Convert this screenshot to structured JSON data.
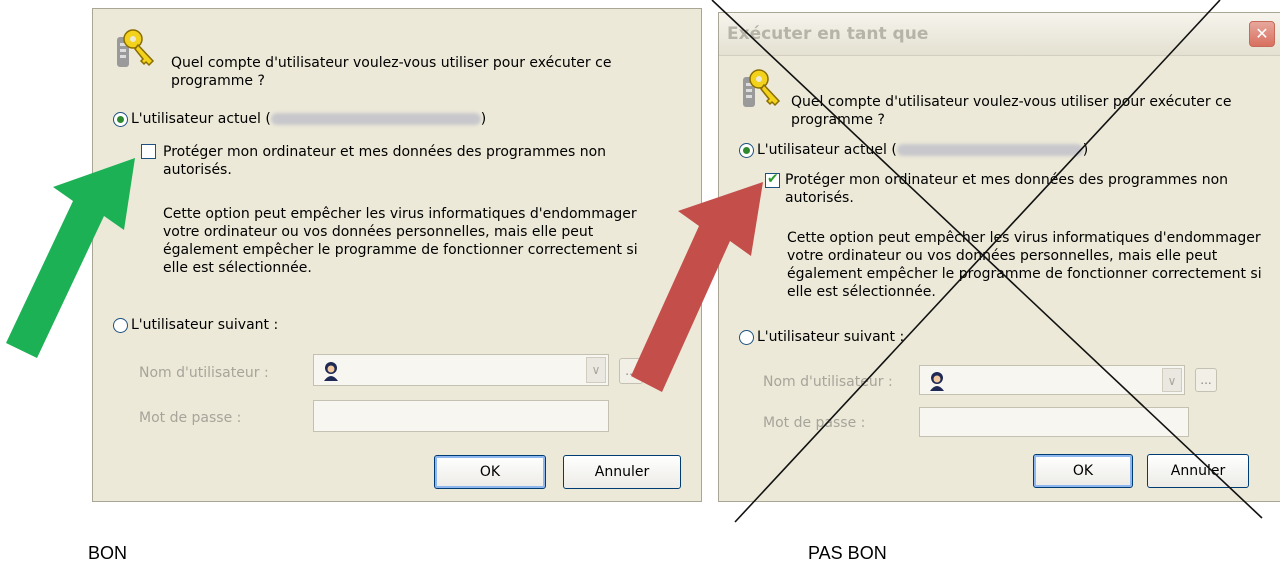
{
  "left_dialog": {
    "question_line1": "Quel compte d'utilisateur voulez-vous utiliser pour exécuter ce",
    "question_line2": "programme ?",
    "current_user_prefix": "L'utilisateur actuel (",
    "current_user_suffix": ")",
    "current_user_selected": true,
    "protect_checked": false,
    "protect_line1": "Protéger mon ordinateur et mes données des programmes non",
    "protect_line2": "autorisés.",
    "desc_line1": "Cette option peut empêcher les virus informatiques d'endommager",
    "desc_line2": "votre ordinateur ou vos données personnelles, mais elle peut",
    "desc_line3": "également empêcher le programme de fonctionner correctement si",
    "desc_line4": "elle est sélectionnée.",
    "following_user_label": "L'utilisateur suivant :",
    "username_label": "Nom d'utilisateur :",
    "password_label": "Mot de passe :",
    "browse_label": "...",
    "ok_label": "OK",
    "cancel_label": "Annuler"
  },
  "right_dialog": {
    "title": "Exécuter en tant que",
    "close_glyph": "✕",
    "question_line1": "Quel compte d'utilisateur voulez-vous utiliser pour exécuter ce",
    "question_line2": "programme ?",
    "current_user_prefix": "L'utilisateur actuel (",
    "current_user_suffix": ")",
    "current_user_selected": true,
    "protect_checked": true,
    "check_glyph": "✔",
    "protect_line1": "Protéger mon ordinateur et mes données des programmes non",
    "protect_line2": "autorisés.",
    "desc_line1": "Cette option peut empêcher les virus informatiques d'endommager",
    "desc_line2": "votre ordinateur ou vos données personnelles, mais elle peut",
    "desc_line3": "également empêcher le programme de fonctionner correctement si",
    "desc_line4": "elle est sélectionnée.",
    "following_user_label": "L'utilisateur suivant :",
    "username_label": "Nom d'utilisateur :",
    "password_label": "Mot de passe :",
    "browse_label": "...",
    "ok_label": "OK",
    "cancel_label": "Annuler"
  },
  "captions": {
    "good": "BON",
    "bad": "PAS BON"
  },
  "icons": {
    "dialog_icon": "keys-icon",
    "user_icon": "user-icon",
    "good_arrow": "green-arrow-icon",
    "bad_arrow": "red-arrow-icon",
    "cross_out": "x-cross-icon"
  },
  "colors": {
    "good_arrow": "#1db155",
    "bad_arrow": "#c44f4a",
    "dialog_bg": "#ece9d8"
  }
}
